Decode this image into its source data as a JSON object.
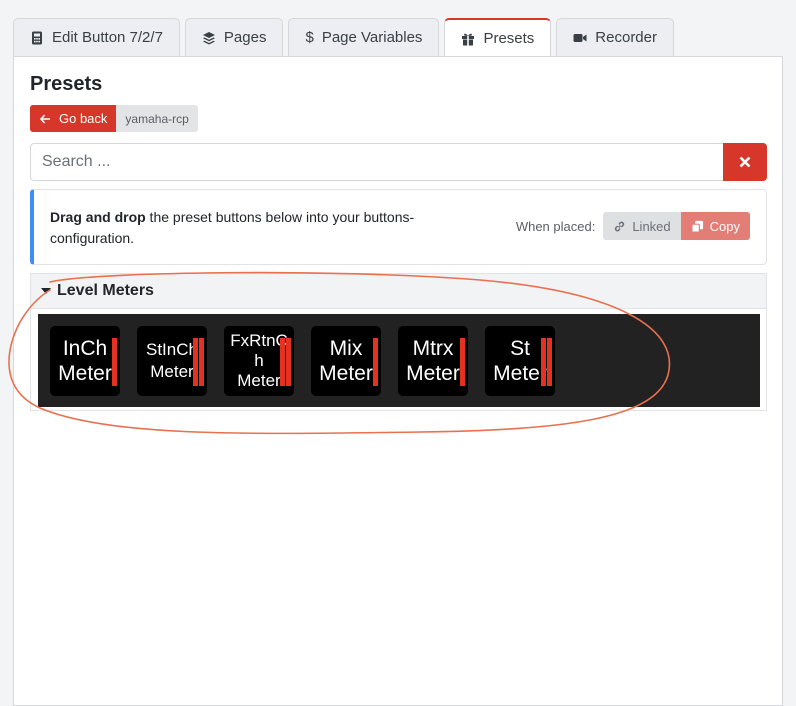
{
  "tabs": [
    {
      "label": "Edit Button 7/2/7",
      "icon": "calculator-icon"
    },
    {
      "label": "Pages",
      "icon": "layers-icon"
    },
    {
      "label": "Page Variables",
      "icon": "dollar-icon"
    },
    {
      "label": "Presets",
      "icon": "gift-icon",
      "active": true
    },
    {
      "label": "Recorder",
      "icon": "video-icon"
    }
  ],
  "panel": {
    "title": "Presets",
    "back_label": "Go back",
    "module_name": "yamaha-rcp"
  },
  "search": {
    "placeholder": "Search ..."
  },
  "info": {
    "bold_text": "Drag and drop",
    "text": " the preset buttons below into your buttons-configuration.",
    "placed_label": "When placed:",
    "linked_label": "Linked",
    "copy_label": "Copy"
  },
  "group": {
    "title": "Level Meters",
    "presets": [
      {
        "line1": "InCh",
        "line2": "Meter"
      },
      {
        "line1": "StInCh",
        "line2": "Meter"
      },
      {
        "line1": "FxRtnC",
        "line2": "h",
        "line3": "Meter"
      },
      {
        "line1": "Mix",
        "line2": "Meter"
      },
      {
        "line1": "Mtrx",
        "line2": "Meter"
      },
      {
        "line1": "St",
        "line2": "Meter"
      }
    ]
  },
  "colors": {
    "accent": "#d7362b",
    "info_border": "#3e8ef7",
    "annotation": "#e8714f",
    "meter": "#e3321f"
  }
}
